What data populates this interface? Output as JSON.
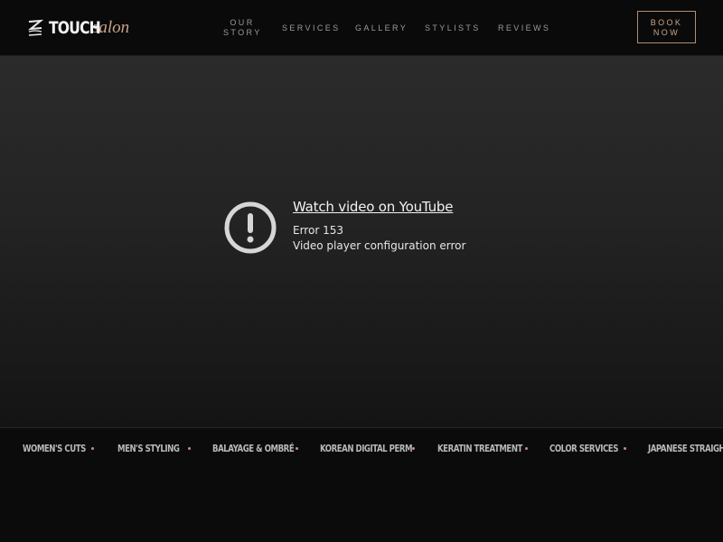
{
  "brand": {
    "main": "TOUCH",
    "sub": "salon",
    "accent_color": "#c9a58a"
  },
  "nav": {
    "items": [
      {
        "label": "OUR STORY"
      },
      {
        "label": "SERVICES"
      },
      {
        "label": "GALLERY"
      },
      {
        "label": "STYLISTS"
      },
      {
        "label": "REVIEWS"
      }
    ],
    "book_label": "BOOK NOW"
  },
  "video": {
    "icon": "alert-circle-icon",
    "link_text": "Watch video on YouTube",
    "error_code": "Error 153",
    "error_message": "Video player configuration error"
  },
  "marquee": {
    "items": [
      "WOMEN'S CUTS",
      "MEN'S STYLING",
      "BALAYAGE & OMBRÉ",
      "KOREAN DIGITAL PERM",
      "KERATIN TREATMENT",
      "COLOR SERVICES",
      "JAPANESE STRAIGHTENING"
    ],
    "dot_color": "#c58c8c"
  }
}
